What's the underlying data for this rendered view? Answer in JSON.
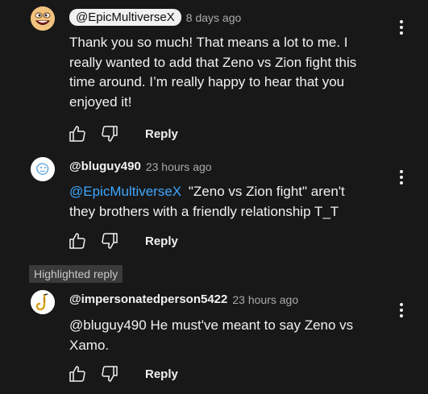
{
  "comments": [
    {
      "author": "@EpicMultiverseX",
      "time": "8 days ago",
      "mention": "",
      "text": "Thank you so much! That means a lot to me. I really wanted to add that Zeno vs Zion fight this time around. I’m really happy to hear that you enjoyed it!",
      "reply_label": "Reply"
    },
    {
      "author": "@bluguy490",
      "time": "23 hours ago",
      "mention": "@EpicMultiverseX",
      "text": "\"Zeno vs Zion fight\" aren't they brothers with a friendly relationship T_T",
      "reply_label": "Reply"
    },
    {
      "author": "@impersonatedperson5422",
      "time": "23 hours ago",
      "mention": "",
      "text": "@bluguy490 He must've meant to say Zeno vs Xamo.",
      "reply_label": "Reply"
    }
  ],
  "highlighted_badge": "Highlighted reply",
  "icons": {
    "like": "thumbs-up-icon",
    "dislike": "thumbs-down-icon",
    "more": "more-vert-icon"
  }
}
